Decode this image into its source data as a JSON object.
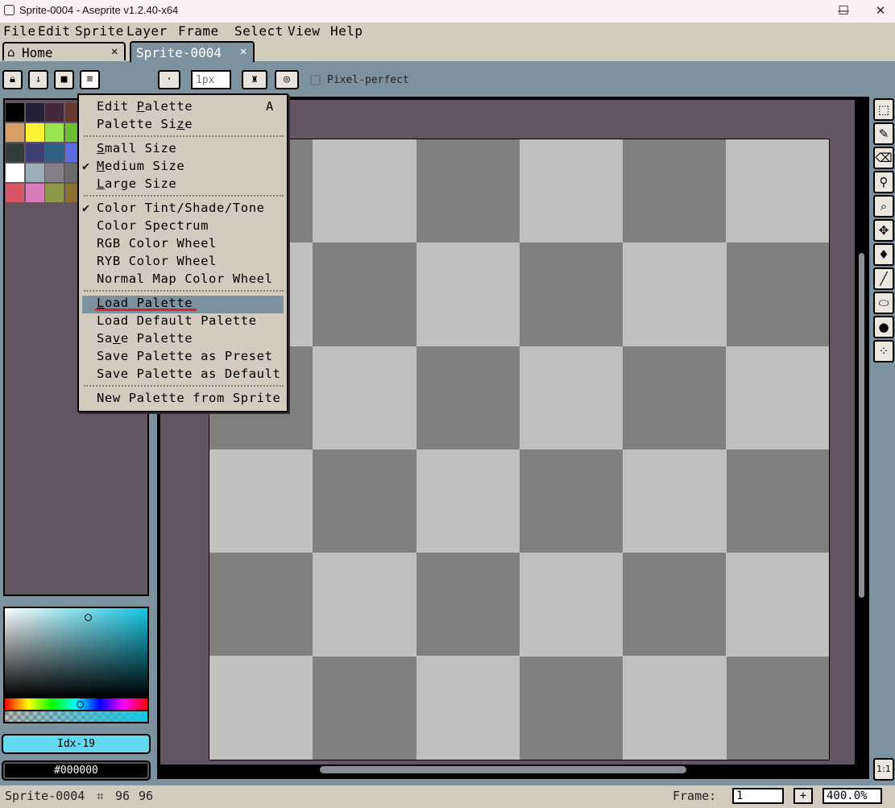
{
  "window": {
    "title": "Sprite-0004 - Aseprite v1.2.40-x64",
    "minimize": "—",
    "maximize": "☐",
    "close": "✕"
  },
  "menubar": {
    "file": "File",
    "edit": "Edit",
    "sprite": "Sprite",
    "layer": "Layer",
    "frame": "Frame",
    "select": "Select",
    "view": "View",
    "help": "Help"
  },
  "tabs": [
    {
      "label": "Home",
      "icon": "home-icon",
      "close": "✕"
    },
    {
      "label": "Sprite-0004",
      "close": "✕",
      "active": true
    }
  ],
  "context_bar": {
    "brush_size_placeholder": "1px",
    "pixel_perfect_label": "Pixel-perfect"
  },
  "palette": {
    "swatches": [
      "#000000",
      "#222034",
      "#45283c",
      "#663931",
      "#d9a066",
      "#fbf236",
      "#99e550",
      "#6abe30",
      "#323c39",
      "#3f3f74",
      "#306082",
      "#5b6ee1",
      "#ffffff",
      "#9badb7",
      "#847e87",
      "#696a6a",
      "#d95763",
      "#d77bba",
      "#8f974a",
      "#8a6f30"
    ]
  },
  "color_bar": {
    "foreground_label": "Idx-19",
    "foreground_color": "#64d8ef",
    "background_label": "#000000"
  },
  "palette_menu": {
    "items": [
      {
        "label": "Edit Palette",
        "ul": "P",
        "shortcut": "A"
      },
      {
        "label": "Palette Size",
        "ul": "z"
      },
      {
        "label": "Small Size",
        "ul": "S"
      },
      {
        "label": "Medium Size",
        "ul": "M",
        "checked": true
      },
      {
        "label": "Large Size",
        "ul": "L"
      },
      {
        "label": "Color Tint/Shade/Tone",
        "checked": true
      },
      {
        "label": "Color Spectrum"
      },
      {
        "label": "RGB Color Wheel"
      },
      {
        "label": "RYB Color Wheel"
      },
      {
        "label": "Normal Map Color Wheel"
      },
      {
        "label": "Load Palette",
        "ul": "L",
        "highlighted": true
      },
      {
        "label": "Load Default Palette"
      },
      {
        "label": "Save Palette",
        "ul": "v"
      },
      {
        "label": "Save Palette as Preset"
      },
      {
        "label": "Save Palette as Default"
      },
      {
        "label": "New Palette from Sprite"
      }
    ]
  },
  "right_toolbar": {
    "zoom_reset": "1:1"
  },
  "status_bar": {
    "sprite_name": "Sprite-0004",
    "size_w": "96",
    "size_h": "96",
    "frame_label": "Frame:",
    "frame_value": "1",
    "add_frame": "+",
    "zoom_value": "400.0%"
  },
  "colors": {
    "background": "#7d929e",
    "panel": "#d3cbbe",
    "canvas_border": "#645562",
    "highlight": "#7d929e",
    "annotation": "#e0202c"
  }
}
